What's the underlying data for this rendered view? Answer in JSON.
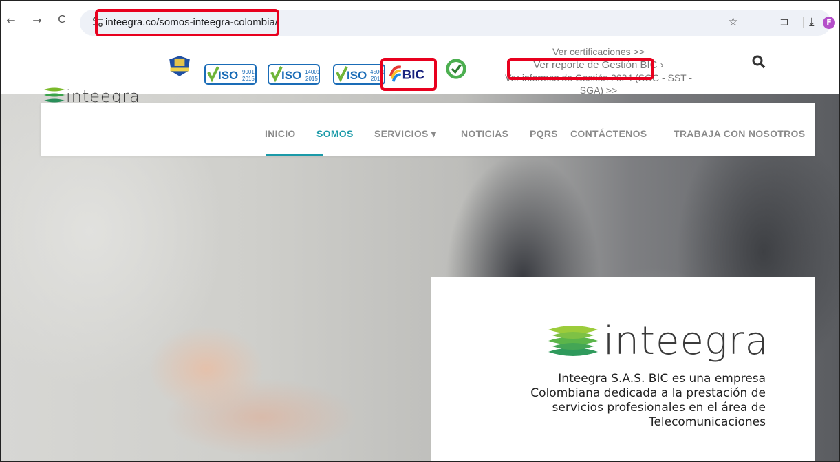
{
  "browser": {
    "url": "inteegra.co/somos-inteegra-colombia/",
    "back_glyph": "←",
    "forward_glyph": "→",
    "reload_glyph": "C",
    "star_glyph": "☆",
    "extensions_glyph": "⊐",
    "download_glyph": "⤓",
    "profile_initial": "F"
  },
  "header": {
    "logo_text": "inteegra",
    "certifications": [
      "ISO 9001 2015",
      "ISO 14001 2015",
      "ISO 45001 2018",
      "BIC"
    ],
    "links": {
      "certificaciones": "Ver certificaciones >>",
      "reporte_bic": "Ver reporte de Gestión BIC ›",
      "informes": "Ver informes de Gestión 2024 (SGC - SST - SGA) >>"
    }
  },
  "nav": {
    "items": [
      {
        "label": "INICIO"
      },
      {
        "label": "SOMOS"
      },
      {
        "label": "SERVICIOS ▾"
      },
      {
        "label": "NOTICIAS"
      },
      {
        "label": "PQRS"
      },
      {
        "label": "CONTÁCTENOS"
      },
      {
        "label": "TRABAJA CON NOSOTROS"
      }
    ],
    "active_color": "#1b9aa8"
  },
  "card": {
    "logo_text": "inteegra",
    "lines": [
      "Inteegra S.A.S. BIC es una empresa",
      "Colombiana dedicada a la prestación de",
      "servicios profesionales en el área de",
      "Telecomunicaciones"
    ]
  },
  "colors": {
    "highlight": "#e8001e",
    "brand_green": "#7ab929",
    "brand_teal": "#1b9aa8"
  }
}
